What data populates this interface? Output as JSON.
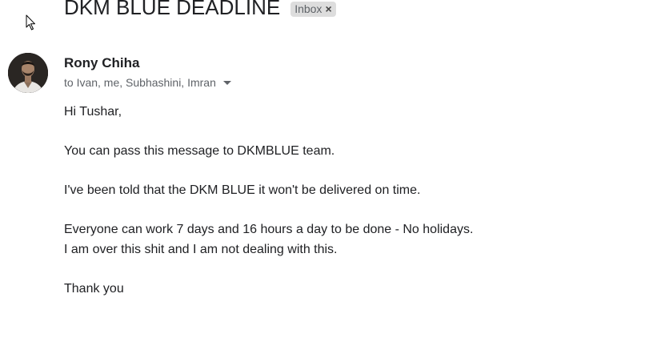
{
  "email": {
    "subject": "DKM BLUE DEADLINE",
    "label": "Inbox",
    "label_remove_glyph": "×",
    "sender": "Rony Chiha",
    "recipients": "to Ivan, me, Subhashini, Imran",
    "body": [
      "Hi Tushar,",
      "",
      "You can pass this message to DKMBLUE team.",
      "",
      "I've been told that the DKM BLUE it won't be delivered on time.",
      "",
      "Everyone can work 7 days and 16 hours a day to be done - No holidays.",
      "I am over this shit and I am not dealing with this.",
      "",
      "Thank you"
    ]
  },
  "icons": {
    "cursor": "mouse-pointer-icon",
    "caret": "chevron-down-icon",
    "avatar": "sender-avatar"
  }
}
